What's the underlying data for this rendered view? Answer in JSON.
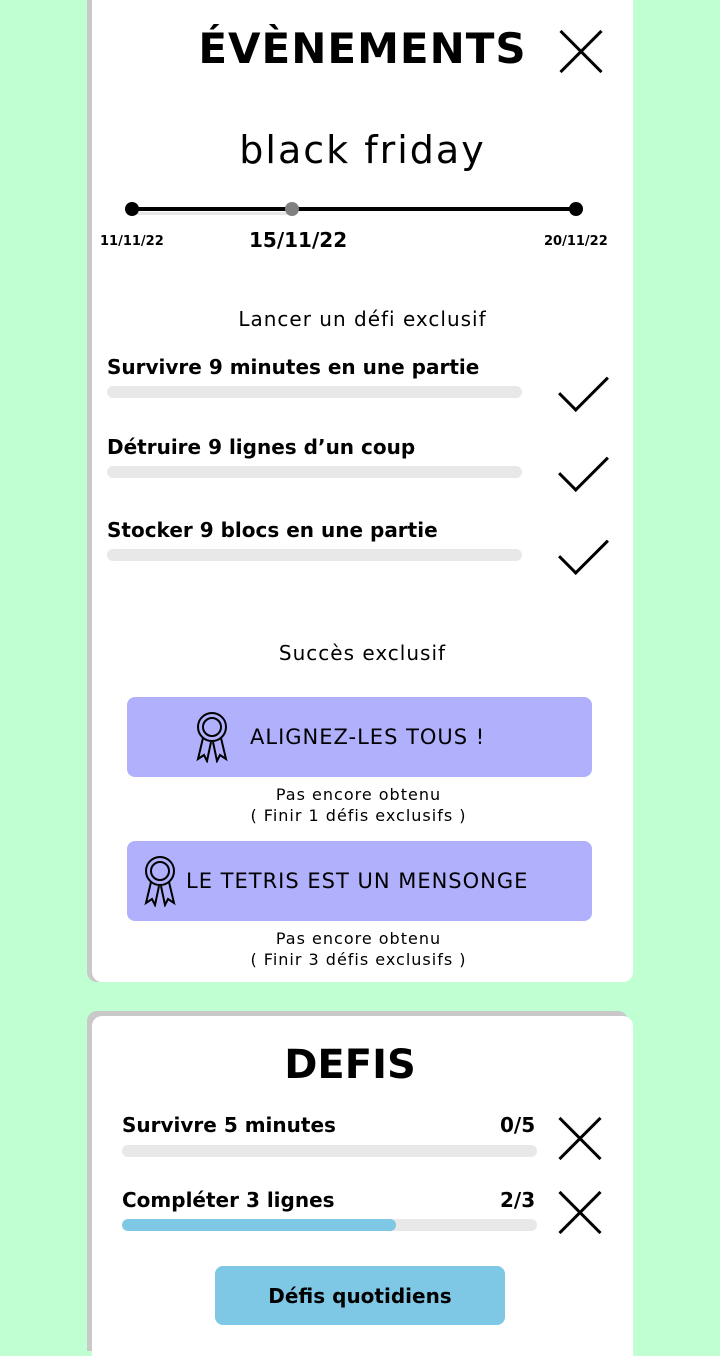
{
  "events": {
    "title": "ÉVÈNEMENTS",
    "event_name": "black friday",
    "timeline": {
      "start": "11/11/22",
      "current": "15/11/22",
      "end": "20/11/22",
      "progress": 0.36
    },
    "challenges_heading": "Lancer un défi exclusif",
    "challenges": [
      {
        "label": "Survivre 9 minutes en une partie",
        "completed": true
      },
      {
        "label": "Détruire 9 lignes d’un coup",
        "completed": true
      },
      {
        "label": "Stocker 9 blocs en une partie",
        "completed": true
      }
    ],
    "achievements_heading": "Succès exclusif",
    "achievements": [
      {
        "label": "ALIGNEZ-LES TOUS !",
        "status": "Pas encore obtenu",
        "requirement": "( Finir 1 défis exclusifs )",
        "icon": "ribbon-medal-icon"
      },
      {
        "label": "LE TETRIS EST UN MENSONGE",
        "status": "Pas encore obtenu",
        "requirement": "( Finir 3 défis exclusifs )",
        "icon": "ribbon-medal-icon"
      }
    ]
  },
  "defis": {
    "title": "DEFIS",
    "items": [
      {
        "label": "Survivre 5 minutes",
        "count": "0/5",
        "progress": 0.0
      },
      {
        "label": "Compléter 3 lignes",
        "count": "2/3",
        "progress": 0.66
      }
    ],
    "daily_button": "Défis quotidiens"
  },
  "colors": {
    "background": "#bfffd2",
    "achievement": "#b0b0fc",
    "accent": "#7ec8e6",
    "bar": "#e8e8e8"
  }
}
